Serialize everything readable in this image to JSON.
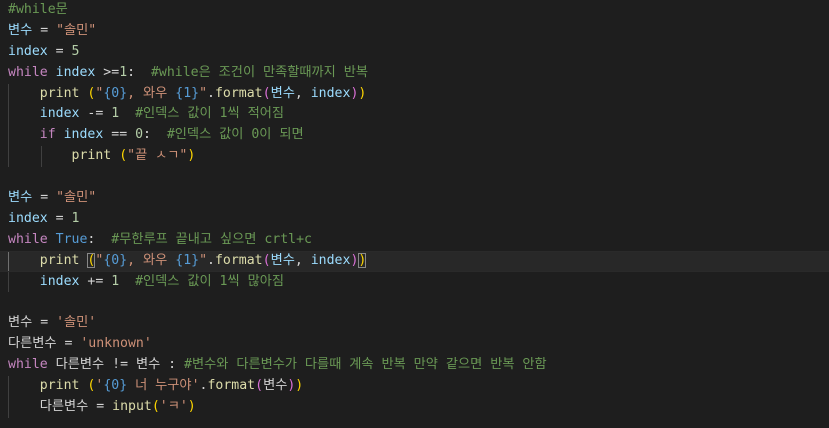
{
  "code": {
    "l1": {
      "comment": "#while문"
    },
    "l2": {
      "var": "변수",
      "op": " = ",
      "str": "\"솔민\""
    },
    "l3": {
      "var": "index",
      "op": " = ",
      "num": "5"
    },
    "l4": {
      "kw": "while",
      "sp": " ",
      "var": "index",
      "op": " >=",
      "num": "1",
      "colon": ":  ",
      "comment": "#while은 조건이 만족할때까지 반복"
    },
    "l5": {
      "indent": "    ",
      "fn": "print",
      "sp": " ",
      "p1o": "(",
      "str1": "\"",
      "ph1": "{0}",
      "str2": ", 와우 ",
      "ph2": "{1}",
      "str3": "\"",
      "dot": ".",
      "fn2": "format",
      "p2o": "(",
      "v1": "변수",
      "comma": ", ",
      "v2": "index",
      "p2c": ")",
      "p1c": ")"
    },
    "l6": {
      "indent": "    ",
      "var": "index",
      "op": " -= ",
      "num": "1",
      "sp": "  ",
      "comment": "#인덱스 값이 1씩 적어짐"
    },
    "l7": {
      "indent": "    ",
      "kw": "if",
      "sp": " ",
      "var": "index",
      "op": " == ",
      "num": "0",
      "colon": ":  ",
      "comment": "#인덱스 값이 0이 되면"
    },
    "l8": {
      "indent": "        ",
      "fn": "print",
      "sp": " ",
      "p1o": "(",
      "str": "\"끝 ㅅㄱ\"",
      "p1c": ")"
    },
    "l9": {
      "text": ""
    },
    "l10": {
      "var": "변수",
      "op": " = ",
      "str": "\"솔민\""
    },
    "l11": {
      "var": "index",
      "op": " = ",
      "num": "1"
    },
    "l12": {
      "kw": "while",
      "sp": " ",
      "tru": "True",
      "colon": ":  ",
      "comment": "#무한루프 끝내고 싶으면 crtl+c"
    },
    "l13": {
      "indent": "    ",
      "fn": "print",
      "sp": " ",
      "p1o": "(",
      "str1": "\"",
      "ph1": "{0}",
      "str2": ", 와우 ",
      "ph2": "{1}",
      "str3": "\"",
      "dot": ".",
      "fn2": "format",
      "p2o": "(",
      "v1": "변수",
      "comma": ", ",
      "v2": "index",
      "p2c": ")",
      "p1c": ")"
    },
    "l14": {
      "indent": "    ",
      "var": "index",
      "op": " += ",
      "num": "1",
      "sp": "  ",
      "comment": "#인덱스 값이 1씩 많아짐"
    },
    "l15": {
      "text": ""
    },
    "l16": {
      "var": "변수",
      "op": " = ",
      "str": "'솔민'"
    },
    "l17": {
      "var": "다른변수",
      "op": " = ",
      "str": "'unknown'"
    },
    "l18": {
      "kw": "while",
      "sp": " ",
      "v1": "다른변수",
      "op": " != ",
      "v2": "변수",
      "colon": " : ",
      "comment": "#변수와 다른변수가 다를때 계속 반복 만약 같으면 반복 안함"
    },
    "l19": {
      "indent": "    ",
      "fn": "print",
      "sp": " ",
      "p1o": "(",
      "str1": "'",
      "ph1": "{0}",
      "str2": " 너 누구야'",
      "dot": ".",
      "fn2": "format",
      "p2o": "(",
      "v1": "변수",
      "p2c": ")",
      "p1c": ")"
    },
    "l20": {
      "indent": "    ",
      "var": "다른변수",
      "op": " = ",
      "fn": "input",
      "p1o": "(",
      "str": "'ㅋ'",
      "p1c": ")"
    }
  },
  "colors": {
    "background": "#1e1e1e",
    "comment": "#6a9955",
    "keyword": "#c586c0",
    "constant": "#569cd6",
    "variable": "#9cdcfe",
    "function": "#dcdcaa",
    "string": "#ce9178",
    "number": "#b5cea8"
  }
}
